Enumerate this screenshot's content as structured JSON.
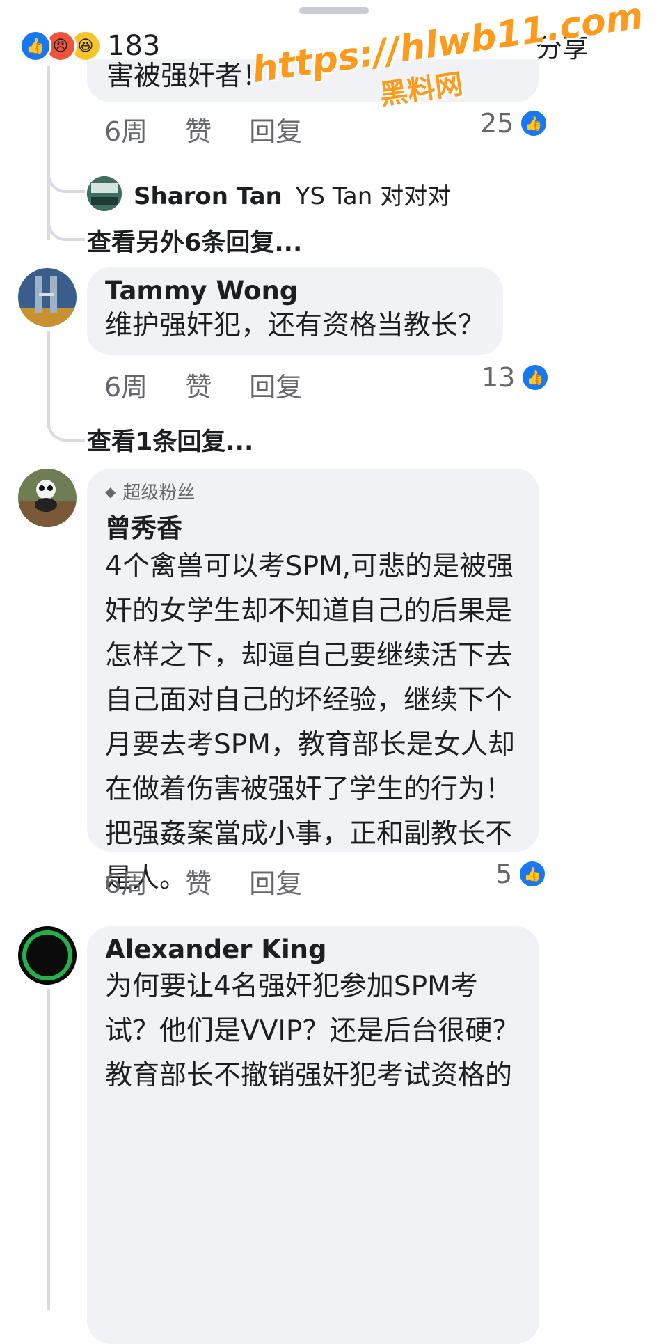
{
  "reactions": {
    "count": "183",
    "share": "分享"
  },
  "watermark": {
    "url": "https://hlwb11.com",
    "label": "黑料网"
  },
  "comments": [
    {
      "partial_text": "害被强奸者！",
      "time": "6周",
      "like": "赞",
      "reply": "回复",
      "likes": "25",
      "nested_reply": {
        "author": "Sharon Tan",
        "text": "YS Tan 对对对"
      },
      "view_more": "查看另外6条回复..."
    },
    {
      "author": "Tammy Wong",
      "text": "维护强奸犯，还有资格当教长？",
      "time": "6周",
      "like": "赞",
      "reply": "回复",
      "likes": "13",
      "view_more": "查看1条回复..."
    },
    {
      "badge": "超级粉丝",
      "author": "曾秀香",
      "lines": [
        "4个禽兽可以考SPM,可悲的是被强",
        "奸的女学生却不知道自己的后果是",
        "怎样之下，却逼自己要继续活下去",
        "自己面对自己的坏经验，继续下个",
        "月要去考SPM，教育部长是女人却",
        "在做着伤害被强奸了学生的行为！",
        "把强姦案當成小事，正和副教长不",
        "是人。"
      ],
      "time": "6周",
      "like": "赞",
      "reply": "回复",
      "likes": "5"
    },
    {
      "author": "Alexander King",
      "lines": [
        "为何要让4名强奸犯参加SPM考",
        "试？他们是VVIP？还是后台很硬？",
        "教育部长不撤销强奸犯考试资格的"
      ]
    }
  ]
}
